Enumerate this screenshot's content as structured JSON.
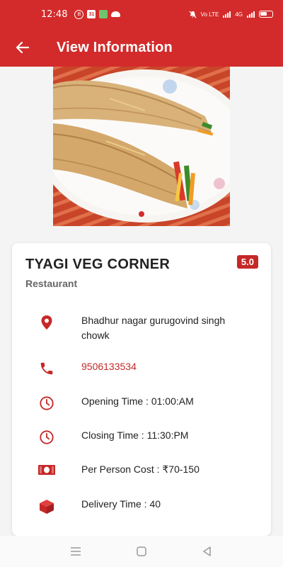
{
  "status_bar": {
    "time": "12:48",
    "notif_1": "B",
    "notif_2": "31",
    "network_label": "Vo LTE",
    "network_label_2": "4G"
  },
  "app_bar": {
    "title": "View Information"
  },
  "carousel": {
    "total_images": 1,
    "active_index": 0
  },
  "restaurant": {
    "name": "TYAGI VEG CORNER",
    "rating": "5.0",
    "type": "Restaurant",
    "address": "Bhadhur nagar gurugovind singh chowk",
    "phone": "9506133534",
    "opening_time": "Opening Time : 01:00:AM",
    "closing_time": "Closing Time : 11:30:PM",
    "per_person_cost": "Per Person Cost : ₹70-150",
    "delivery_time": "Delivery Time : 40"
  },
  "colors": {
    "primary": "#d32b2b",
    "icon": "#c62828"
  }
}
